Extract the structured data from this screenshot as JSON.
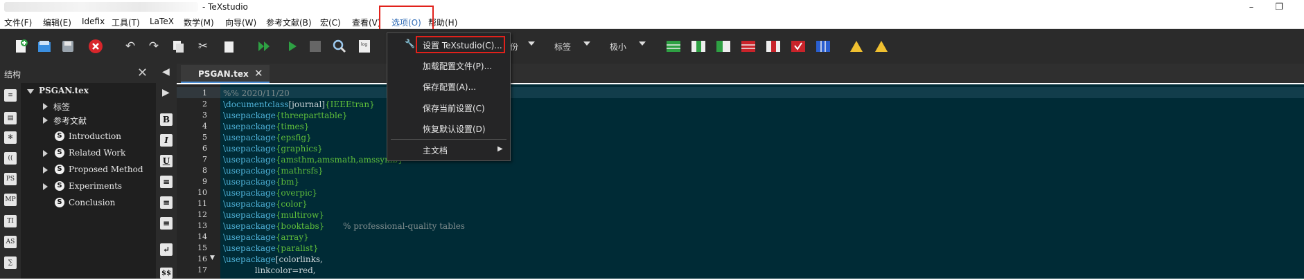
{
  "window": {
    "title": "- TeXstudio",
    "minimize": "–",
    "restore": "❐"
  },
  "menubar": {
    "items": [
      "文件(F)",
      "编辑(E)",
      "Idefix",
      "工具(T)",
      "LaTeX",
      "数学(M)",
      "向导(W)",
      "参考文献(B)",
      "宏(C)",
      "查看(V)",
      "选项(O)",
      "帮助(H)"
    ],
    "active": "选项(O)"
  },
  "toolbar": {
    "combo1_label": "份",
    "combo2_label": "标签",
    "combo3_label": "极小"
  },
  "options_menu": {
    "items": [
      {
        "label": "设置 TeXstudio(C)...",
        "highlighted": true
      },
      {
        "label": "加载配置文件(P)..."
      },
      {
        "label": "保存配置(A)..."
      },
      {
        "label": "保存当前设置(C)"
      },
      {
        "label": "恢复默认设置(D)"
      },
      {
        "label": "主文档",
        "submenu": true
      }
    ],
    "arrow": "▶"
  },
  "structure": {
    "title": "结构",
    "close": "✕",
    "root": "PSGAN.tex",
    "nodes": [
      {
        "label": "标签"
      },
      {
        "label": "参考文献"
      },
      {
        "label": "Introduction"
      },
      {
        "label": "Related Work"
      },
      {
        "label": "Proposed Method"
      },
      {
        "label": "Experiments"
      },
      {
        "label": "Conclusion"
      }
    ],
    "section_icon": "S"
  },
  "left_icons": [
    "≡",
    "▤",
    "✻",
    "(⁡(",
    "PS",
    "MP",
    "TI",
    "AS",
    "∑"
  ],
  "format_icons": [
    "B",
    "I",
    "U",
    "≡",
    "≡",
    "≡",
    "↵",
    "$$"
  ],
  "editor_tab": {
    "label": "PSGAN.tex",
    "close": "✕"
  },
  "editor": {
    "lines": [
      {
        "n": "1",
        "parts": [
          {
            "t": "%% 2020/11/20",
            "c": "cmt"
          }
        ]
      },
      {
        "n": "2",
        "parts": [
          {
            "t": "\\documentclass",
            "c": "kw"
          },
          {
            "t": "[journal]",
            "c": "txt"
          },
          {
            "t": "{IEEEtran}",
            "c": "arg"
          }
        ]
      },
      {
        "n": "3",
        "parts": [
          {
            "t": "\\usepackage",
            "c": "kw"
          },
          {
            "t": "{threeparttable}",
            "c": "arg"
          }
        ]
      },
      {
        "n": "4",
        "parts": [
          {
            "t": "\\usepackage",
            "c": "kw"
          },
          {
            "t": "{times}",
            "c": "arg"
          }
        ]
      },
      {
        "n": "5",
        "parts": [
          {
            "t": "\\usepackage",
            "c": "kw"
          },
          {
            "t": "{epsfig}",
            "c": "arg"
          }
        ]
      },
      {
        "n": "6",
        "parts": [
          {
            "t": "\\usepackage",
            "c": "kw"
          },
          {
            "t": "{graphics}",
            "c": "arg"
          }
        ]
      },
      {
        "n": "7",
        "parts": [
          {
            "t": "\\usepackage",
            "c": "kw"
          },
          {
            "t": "{amsthm,amsmath,amssymb}",
            "c": "arg"
          }
        ]
      },
      {
        "n": "8",
        "parts": [
          {
            "t": "\\usepackage",
            "c": "kw"
          },
          {
            "t": "{mathrsfs}",
            "c": "arg"
          }
        ]
      },
      {
        "n": "9",
        "parts": [
          {
            "t": "\\usepackage",
            "c": "kw"
          },
          {
            "t": "{bm}",
            "c": "arg"
          }
        ]
      },
      {
        "n": "10",
        "parts": [
          {
            "t": "\\usepackage",
            "c": "kw"
          },
          {
            "t": "{overpic}",
            "c": "arg"
          }
        ]
      },
      {
        "n": "11",
        "parts": [
          {
            "t": "\\usepackage",
            "c": "kw"
          },
          {
            "t": "{color}",
            "c": "arg"
          }
        ]
      },
      {
        "n": "12",
        "parts": [
          {
            "t": "\\usepackage",
            "c": "kw"
          },
          {
            "t": "{multirow}",
            "c": "arg"
          }
        ]
      },
      {
        "n": "13",
        "parts": [
          {
            "t": "\\usepackage",
            "c": "kw"
          },
          {
            "t": "{booktabs}",
            "c": "arg"
          },
          {
            "t": "       % professional-quality tables",
            "c": "cmt"
          }
        ]
      },
      {
        "n": "14",
        "parts": [
          {
            "t": "\\usepackage",
            "c": "kw"
          },
          {
            "t": "{array}",
            "c": "arg"
          }
        ]
      },
      {
        "n": "15",
        "parts": [
          {
            "t": "\\usepackage",
            "c": "kw"
          },
          {
            "t": "{paralist}",
            "c": "arg"
          }
        ]
      },
      {
        "n": "16",
        "parts": [
          {
            "t": "\\usepackage",
            "c": "kw"
          },
          {
            "t": "[colorlinks,",
            "c": "txt"
          }
        ]
      },
      {
        "n": "17",
        "parts": [
          {
            "t": "            linkcolor=red,",
            "c": "txt"
          }
        ]
      }
    ]
  },
  "colors": {
    "editor_bg": "#002b36",
    "keyword": "#4fb3d9",
    "argument": "#5fbf3b",
    "highlight_box": "#e1211b"
  }
}
